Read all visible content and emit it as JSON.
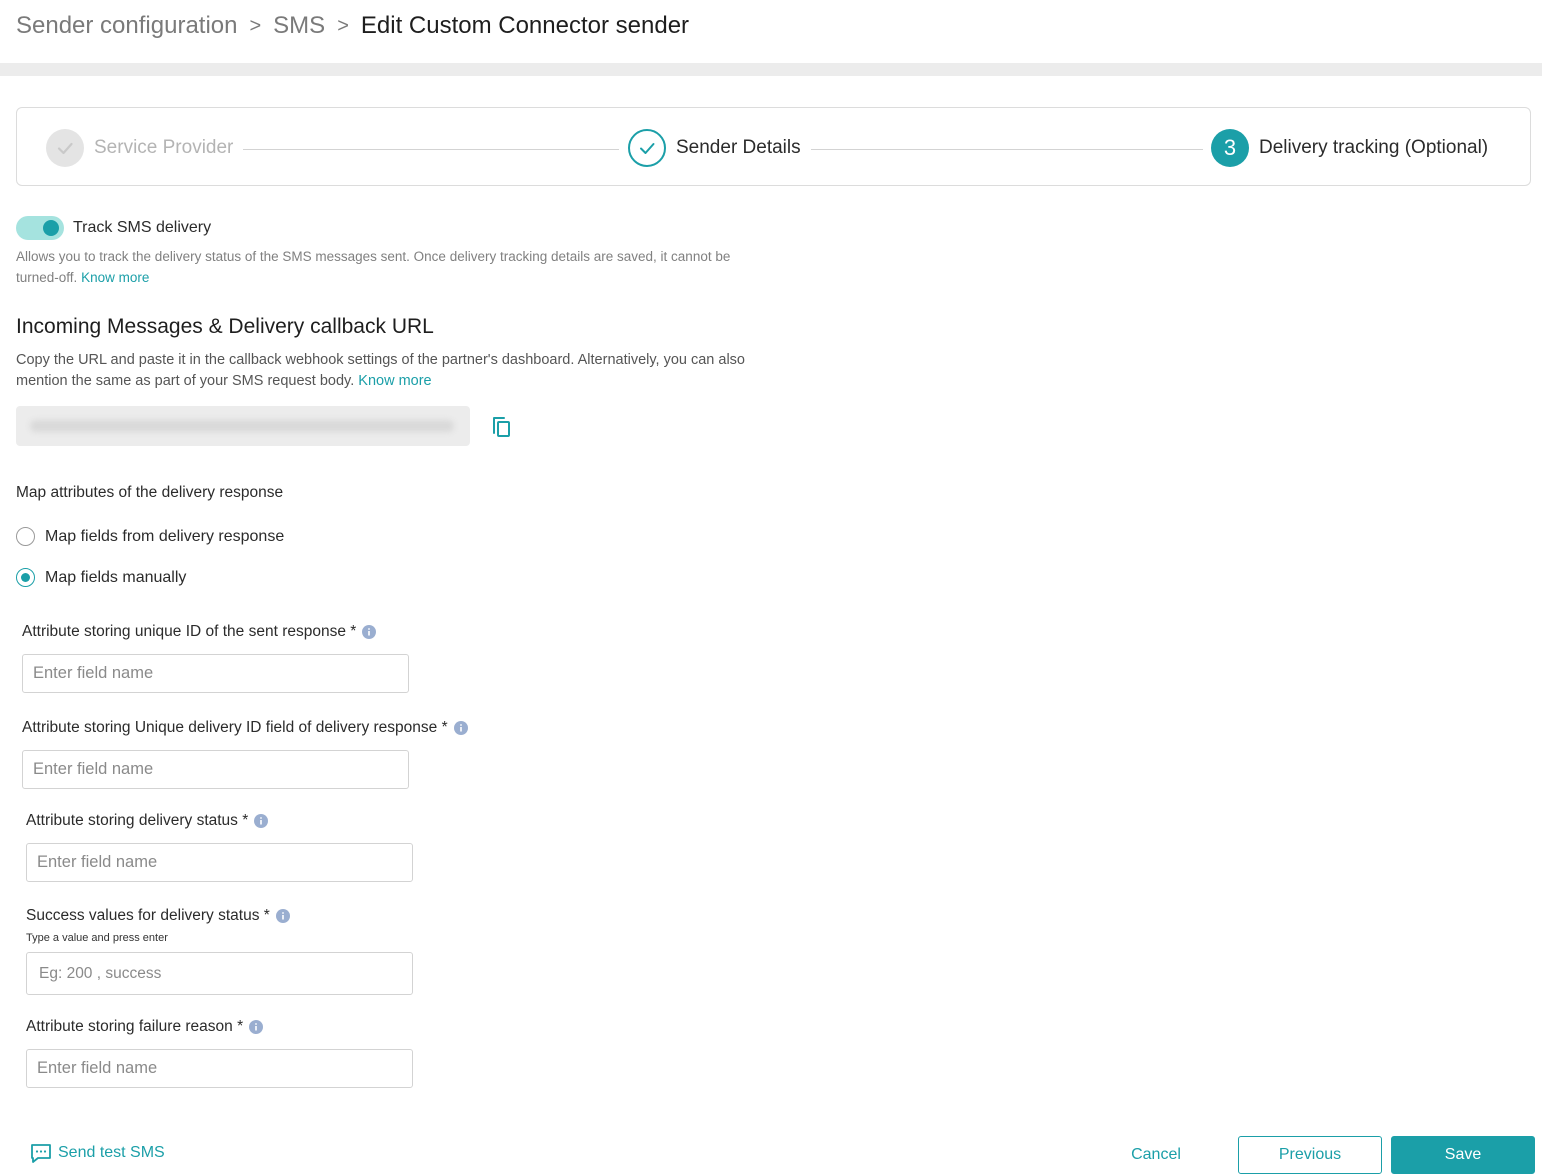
{
  "breadcrumb": {
    "items": [
      "Sender configuration",
      "SMS",
      "Edit Custom Connector sender"
    ],
    "separator": ">"
  },
  "stepper": {
    "steps": [
      {
        "label": "Service Provider",
        "state": "completed-disabled"
      },
      {
        "label": "Sender Details",
        "state": "completed"
      },
      {
        "label": "Delivery tracking (Optional)",
        "number": "3",
        "state": "active"
      }
    ]
  },
  "tracking": {
    "toggle_label": "Track SMS delivery",
    "toggle_on": true,
    "help_text": "Allows you to track the delivery status of the SMS messages sent. Once delivery tracking details are saved, it cannot be turned-off.",
    "help_link": "Know more"
  },
  "callback": {
    "title": "Incoming Messages & Delivery callback URL",
    "description": "Copy the URL and paste it in the callback webhook settings of the partner's dashboard. Alternatively, you can also mention the same as part of your SMS request body.",
    "link": "Know more"
  },
  "mapping": {
    "title": "Map attributes of the delivery response",
    "options": [
      {
        "label": "Map fields from delivery response",
        "checked": false
      },
      {
        "label": "Map fields manually",
        "checked": true
      }
    ]
  },
  "fields": [
    {
      "label": "Attribute storing unique ID of the sent response *",
      "placeholder": "Enter field name"
    },
    {
      "label": "Attribute storing Unique delivery ID field of delivery response *",
      "placeholder": "Enter field name"
    },
    {
      "label": "Attribute storing delivery status *",
      "placeholder": "Enter field name"
    },
    {
      "label": "Success values for delivery status *",
      "hint": "Type a value and press enter",
      "placeholder": "Eg: 200 , success"
    },
    {
      "label": "Attribute storing failure reason *",
      "placeholder": "Enter field name"
    }
  ],
  "footer": {
    "send_test": "Send test SMS",
    "cancel": "Cancel",
    "previous": "Previous",
    "save": "Save"
  },
  "colors": {
    "accent": "#1b9fa8",
    "toggle_track": "#a5e3df",
    "info_icon": "#9aaed0"
  },
  "icons": {
    "copy": "copy-icon",
    "info": "info-icon",
    "check": "check-icon",
    "message": "message-icon"
  }
}
